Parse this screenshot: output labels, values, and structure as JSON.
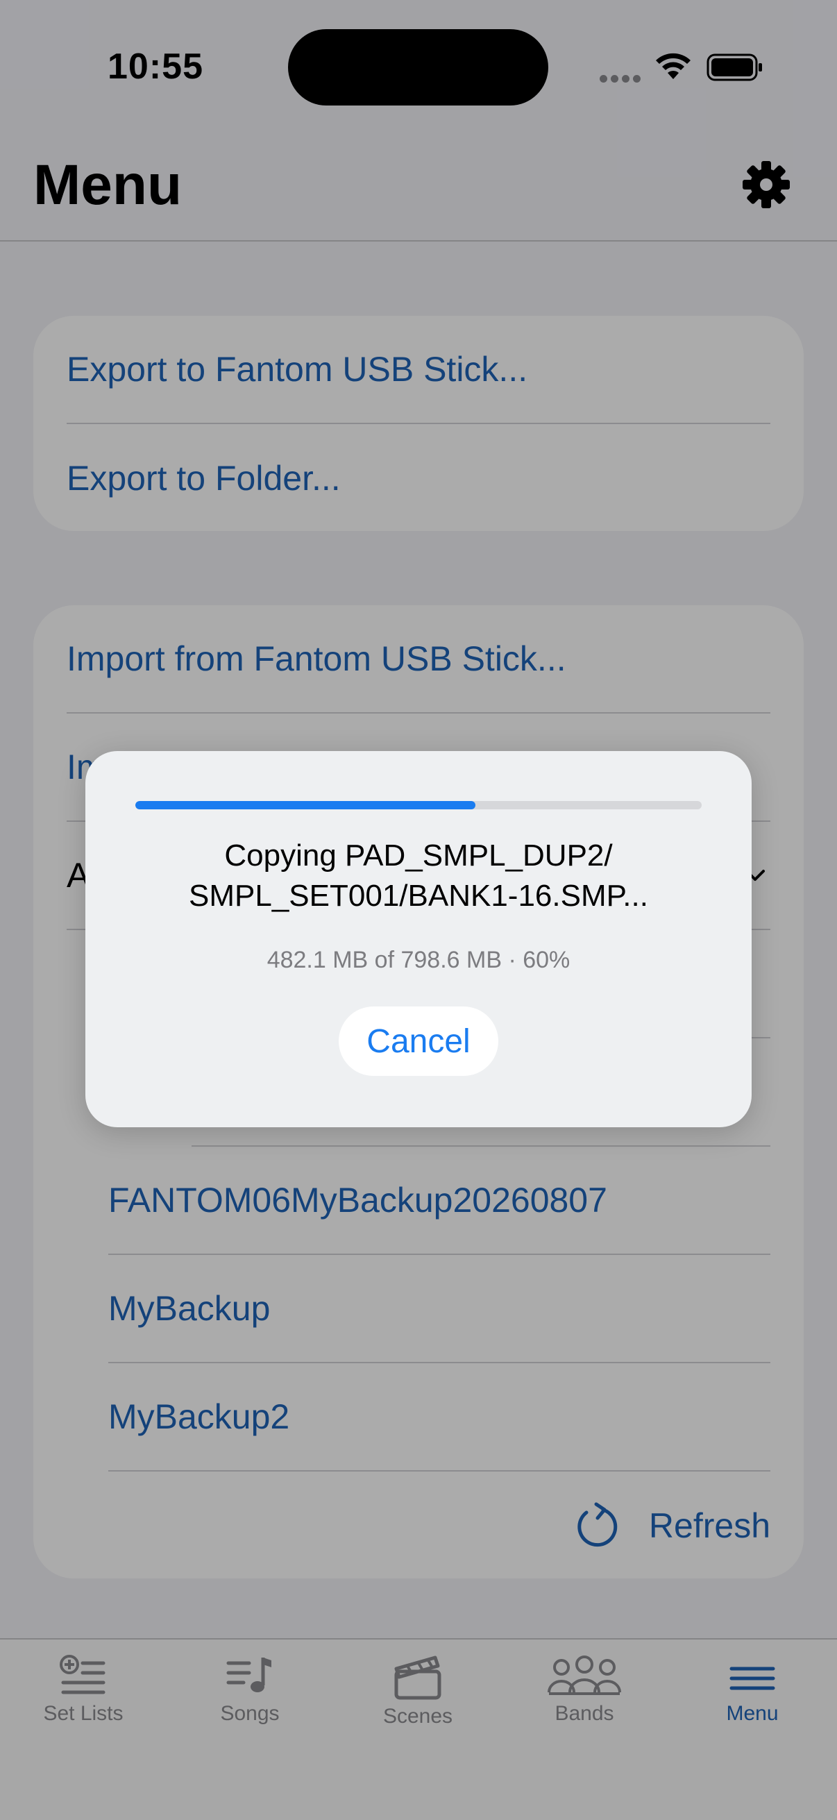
{
  "status_bar": {
    "time": "10:55"
  },
  "header": {
    "title": "Menu"
  },
  "export_card": {
    "items": [
      {
        "label": "Export to Fantom USB Stick..."
      },
      {
        "label": "Export to Folder..."
      }
    ]
  },
  "import_card": {
    "items": [
      {
        "label": "Import from Fantom USB Stick..."
      },
      {
        "label": "Im"
      },
      {
        "label": "A"
      }
    ],
    "backups": [
      {
        "label": "FANTOM06MyBackup20260807"
      },
      {
        "label": "MyBackup"
      },
      {
        "label": "MyBackup2"
      }
    ],
    "refresh_label": "Refresh"
  },
  "tab_bar": {
    "tabs": [
      {
        "label": "Set Lists"
      },
      {
        "label": "Songs"
      },
      {
        "label": "Scenes"
      },
      {
        "label": "Bands"
      },
      {
        "label": "Menu"
      }
    ]
  },
  "progress_alert": {
    "title_line1": "Copying PAD_SMPL_DUP2/",
    "title_line2": "SMPL_SET001/BANK1-16.SMP...",
    "subtitle": "482.1 MB of 798.6 MB · 60%",
    "progress_fraction": 0.6,
    "cancel_label": "Cancel"
  },
  "colors": {
    "accent": "#1a7cf0",
    "link": "#1f63b6",
    "inactive": "#8a8a8e"
  }
}
